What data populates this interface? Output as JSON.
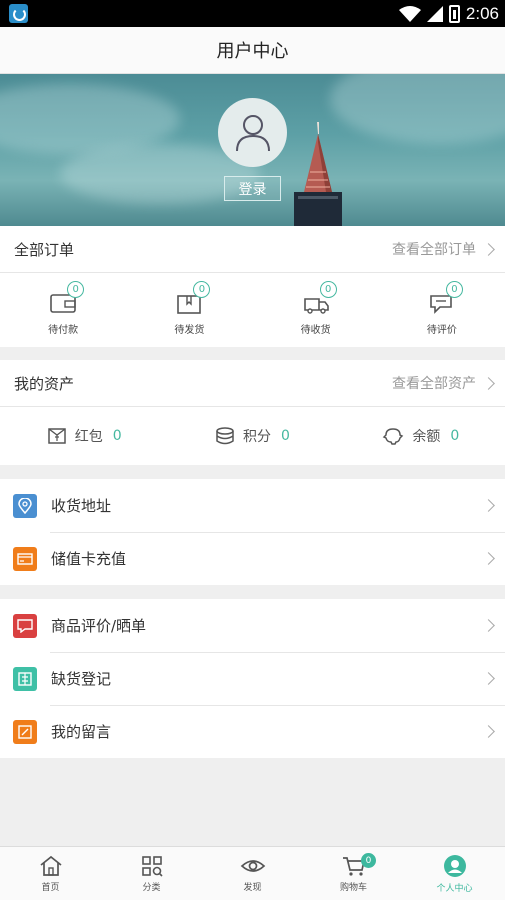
{
  "status_bar": {
    "time": "2:06"
  },
  "header": {
    "title": "用户中心"
  },
  "profile": {
    "login_label": "登录"
  },
  "orders": {
    "title": "全部订单",
    "more": "查看全部订单",
    "items": [
      {
        "label": "待付款",
        "count": "0",
        "icon": "wallet-icon"
      },
      {
        "label": "待发货",
        "count": "0",
        "icon": "package-icon"
      },
      {
        "label": "待收货",
        "count": "0",
        "icon": "truck-icon"
      },
      {
        "label": "待评价",
        "count": "0",
        "icon": "comment-icon"
      }
    ]
  },
  "assets": {
    "title": "我的资产",
    "more": "查看全部资产",
    "items": [
      {
        "label": "红包",
        "value": "0",
        "icon": "red-envelope-icon"
      },
      {
        "label": "积分",
        "value": "0",
        "icon": "coins-icon"
      },
      {
        "label": "余额",
        "value": "0",
        "icon": "piggy-bank-icon"
      }
    ]
  },
  "menu_group1": [
    {
      "label": "收货地址",
      "icon": "location-icon",
      "color": "#4a8fd1"
    },
    {
      "label": "储值卡充值",
      "icon": "card-icon",
      "color": "#f07d1a"
    }
  ],
  "menu_group2": [
    {
      "label": "商品评价/晒单",
      "icon": "review-icon",
      "color": "#d94040"
    },
    {
      "label": "缺货登记",
      "icon": "register-icon",
      "color": "#3fc0a6"
    },
    {
      "label": "我的留言",
      "icon": "message-icon",
      "color": "#f07d1a"
    }
  ],
  "tabbar": {
    "items": [
      {
        "label": "首页",
        "icon": "home-icon"
      },
      {
        "label": "分类",
        "icon": "category-icon"
      },
      {
        "label": "发现",
        "icon": "eye-icon"
      },
      {
        "label": "购物车",
        "icon": "cart-icon",
        "badge": "0"
      },
      {
        "label": "个人中心",
        "icon": "user-icon",
        "active": true
      }
    ]
  },
  "colors": {
    "accent": "#3db89e",
    "badge_ring": "#45b8a0"
  }
}
